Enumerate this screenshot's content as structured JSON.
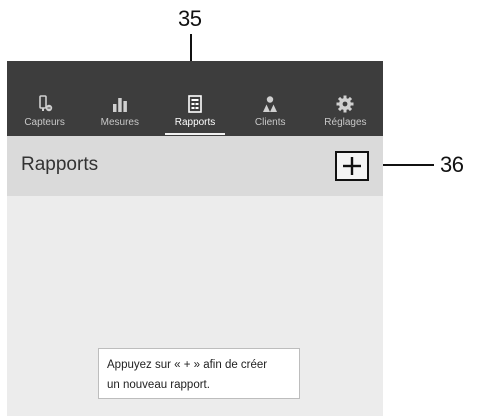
{
  "callouts": {
    "tab_ref": "35",
    "add_ref": "36"
  },
  "tabs": [
    {
      "label": "Capteurs",
      "icon": "sensor-icon",
      "active": false
    },
    {
      "label": "Mesures",
      "icon": "bar-chart-icon",
      "active": false
    },
    {
      "label": "Rapports",
      "icon": "report-icon",
      "active": true
    },
    {
      "label": "Clients",
      "icon": "users-icon",
      "active": false
    },
    {
      "label": "Réglages",
      "icon": "gear-icon",
      "active": false
    }
  ],
  "header": {
    "title": "Rapports",
    "add_icon": "plus-icon"
  },
  "hint": {
    "line1": "Appuyez sur « + » afin de créer",
    "line2": "un nouveau rapport."
  },
  "colors": {
    "tabbar": "#3d3d3d",
    "header": "#dadada",
    "content": "#ececec",
    "tab_label": "#c8c8c8",
    "tab_label_active": "#ffffff"
  }
}
